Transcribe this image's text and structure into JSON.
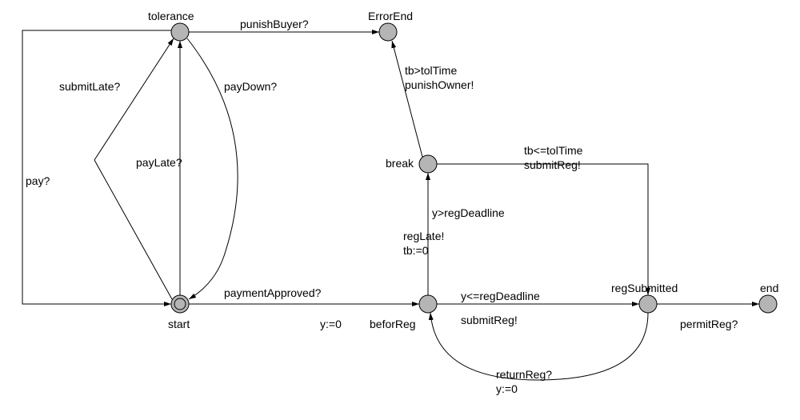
{
  "states": {
    "tolerance": "tolerance",
    "start": "start",
    "errorEnd": "ErrorEnd",
    "break": "break",
    "beforReg": "beforReg",
    "regSubmitted": "regSubmitted",
    "end": "end"
  },
  "edges": {
    "punishBuyer": "punishBuyer?",
    "submitLate": "submitLate?",
    "payDown": "payDown?",
    "payLate": "payLate?",
    "pay": "pay?",
    "paymentApproved": "paymentApproved?",
    "y0_1": "y:=0",
    "tb_gt": "tb>tolTime",
    "punishOwner": "punishOwner!",
    "tb_le": "tb<=tolTime",
    "submitReg1": "submitReg!",
    "y_gt": "y>regDeadline",
    "regLate": "regLate!",
    "tb0": "tb:=0",
    "y_le": "y<=regDeadline",
    "submitReg2": "submitReg!",
    "returnReg": "returnReg?",
    "y0_2": "y:=0",
    "permitReg": "permitReg?"
  }
}
